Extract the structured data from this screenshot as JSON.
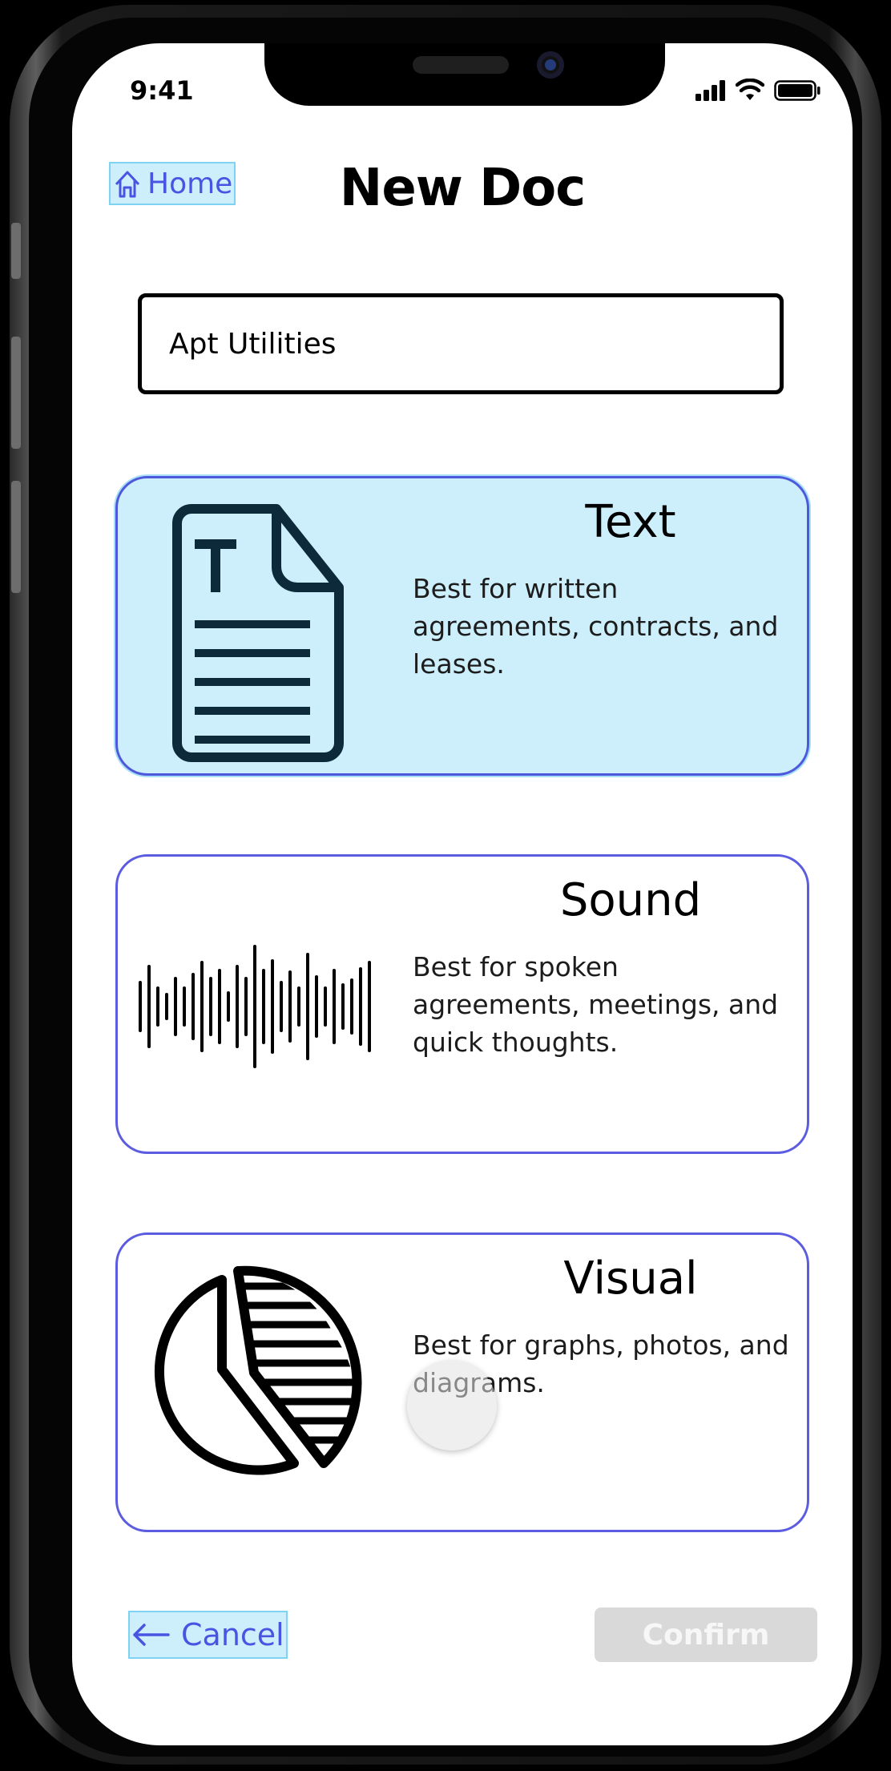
{
  "status_bar": {
    "time": "9:41"
  },
  "header": {
    "home_label": "Home",
    "title": "New Doc"
  },
  "doc_name": {
    "value": "Apt Utilities"
  },
  "doc_types": [
    {
      "title": "Text",
      "description": "Best for written agreements, contracts, and leases.",
      "icon": "text-document-icon",
      "selected": true
    },
    {
      "title": "Sound",
      "description": "Best for spoken agreements, meetings, and quick thoughts.",
      "icon": "sound-wave-icon",
      "selected": false
    },
    {
      "title": "Visual",
      "description": "Best for graphs, photos, and diagrams.",
      "icon": "pie-chart-icon",
      "selected": false
    }
  ],
  "footer": {
    "cancel_label": "Cancel",
    "confirm_label": "Confirm",
    "confirm_enabled": false
  },
  "colors": {
    "accent": "#4a54e3",
    "selected_fill": "#cdeefb",
    "card_border": "#5c5ce0",
    "disabled_button": "#d9d9d9"
  }
}
